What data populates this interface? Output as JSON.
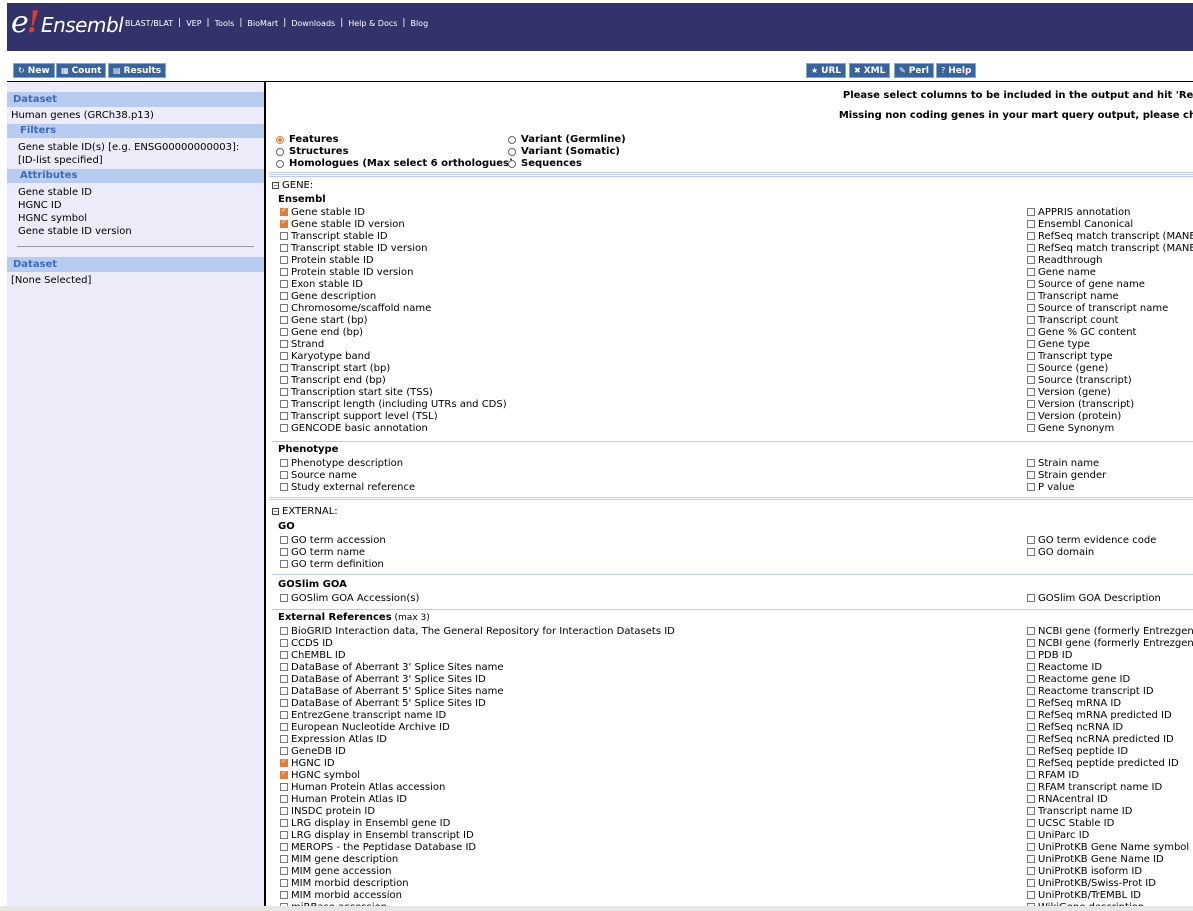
{
  "logo": {
    "e": "e",
    "bang": "!",
    "word": "Ensembl"
  },
  "topnav": [
    "BLAST/BLAT",
    "VEP",
    "Tools",
    "BioMart",
    "Downloads",
    "Help & Docs",
    "Blog"
  ],
  "toolbar": {
    "new_label": "New",
    "count_label": "Count",
    "results_label": "Results",
    "url_label": "URL",
    "xml_label": "XML",
    "perl_label": "Perl",
    "help_label": "Help"
  },
  "sidebar": {
    "dataset_head": "Dataset",
    "dataset_value": "Human genes (GRCh38.p13)",
    "filters_head": "Filters",
    "filter_value": "Gene stable ID(s) [e.g. ENSG00000000003]: [ID-list specified]",
    "attributes_head": "Attributes",
    "attributes": [
      "Gene stable ID",
      "HGNC ID",
      "HGNC symbol",
      "Gene stable ID version"
    ],
    "dataset2_head": "Dataset",
    "dataset2_value": "[None Selected]"
  },
  "messages": {
    "line1": "Please select columns to be included in the output and hit 'Results' when ready",
    "line2": "Missing non coding genes in your mart query output, please check the following"
  },
  "radios": {
    "features": "Features",
    "structures": "Structures",
    "homologues": "Homologues (Max select 6 orthologues)",
    "germline": "Variant (Germline)",
    "somatic": "Variant (Somatic)",
    "sequences": "Sequences",
    "selected": "features"
  },
  "gene_section": {
    "head": "GENE:",
    "ensembl_title": "Ensembl",
    "ensembl_left": [
      {
        "label": "Gene stable ID",
        "checked": true
      },
      {
        "label": "Gene stable ID version",
        "checked": true
      },
      {
        "label": "Transcript stable ID",
        "checked": false
      },
      {
        "label": "Transcript stable ID version",
        "checked": false
      },
      {
        "label": "Protein stable ID",
        "checked": false
      },
      {
        "label": "Protein stable ID version",
        "checked": false
      },
      {
        "label": "Exon stable ID",
        "checked": false
      },
      {
        "label": "Gene description",
        "checked": false
      },
      {
        "label": "Chromosome/scaffold name",
        "checked": false
      },
      {
        "label": "Gene start (bp)",
        "checked": false
      },
      {
        "label": "Gene end (bp)",
        "checked": false
      },
      {
        "label": "Strand",
        "checked": false
      },
      {
        "label": "Karyotype band",
        "checked": false
      },
      {
        "label": "Transcript start (bp)",
        "checked": false
      },
      {
        "label": "Transcript end (bp)",
        "checked": false
      },
      {
        "label": "Transcription start site (TSS)",
        "checked": false
      },
      {
        "label": "Transcript length (including UTRs and CDS)",
        "checked": false
      },
      {
        "label": "Transcript support level (TSL)",
        "checked": false
      },
      {
        "label": "GENCODE basic annotation",
        "checked": false
      }
    ],
    "ensembl_right": [
      {
        "label": "APPRIS annotation",
        "checked": false
      },
      {
        "label": "Ensembl Canonical",
        "checked": false
      },
      {
        "label": "RefSeq match transcript (MANE Select)",
        "checked": false
      },
      {
        "label": "RefSeq match transcript (MANE Plus Clinical)",
        "checked": false
      },
      {
        "label": "Readthrough",
        "checked": false
      },
      {
        "label": "Gene name",
        "checked": false
      },
      {
        "label": "Source of gene name",
        "checked": false
      },
      {
        "label": "Transcript name",
        "checked": false
      },
      {
        "label": "Source of transcript name",
        "checked": false
      },
      {
        "label": "Transcript count",
        "checked": false
      },
      {
        "label": "Gene % GC content",
        "checked": false
      },
      {
        "label": "Gene type",
        "checked": false
      },
      {
        "label": "Transcript type",
        "checked": false
      },
      {
        "label": "Source (gene)",
        "checked": false
      },
      {
        "label": "Source (transcript)",
        "checked": false
      },
      {
        "label": "Version (gene)",
        "checked": false
      },
      {
        "label": "Version (transcript)",
        "checked": false
      },
      {
        "label": "Version (protein)",
        "checked": false
      },
      {
        "label": "Gene Synonym",
        "checked": false
      }
    ],
    "phenotype_title": "Phenotype",
    "phenotype_left": [
      {
        "label": "Phenotype description",
        "checked": false
      },
      {
        "label": "Source name",
        "checked": false
      },
      {
        "label": "Study external reference",
        "checked": false
      }
    ],
    "phenotype_right": [
      {
        "label": "Strain name",
        "checked": false
      },
      {
        "label": "Strain gender",
        "checked": false
      },
      {
        "label": "P value",
        "checked": false
      }
    ]
  },
  "external_section": {
    "head": "EXTERNAL:",
    "go_title": "GO",
    "go_left": [
      {
        "label": "GO term accession",
        "checked": false
      },
      {
        "label": "GO term name",
        "checked": false
      },
      {
        "label": "GO term definition",
        "checked": false
      }
    ],
    "go_right": [
      {
        "label": "GO term evidence code",
        "checked": false
      },
      {
        "label": "GO domain",
        "checked": false
      }
    ],
    "goslim_title": "GOSlim GOA",
    "goslim_left": [
      {
        "label": "GOSlim GOA Accession(s)",
        "checked": false
      }
    ],
    "goslim_right": [
      {
        "label": "GOSlim GOA Description",
        "checked": false
      }
    ],
    "xref_title": "External References",
    "xref_note": " (max 3)",
    "xref_left": [
      {
        "label": "BioGRID Interaction data, The General Repository for Interaction Datasets ID",
        "checked": false
      },
      {
        "label": "CCDS ID",
        "checked": false
      },
      {
        "label": "ChEMBL ID",
        "checked": false
      },
      {
        "label": "DataBase of Aberrant 3' Splice Sites name",
        "checked": false
      },
      {
        "label": "DataBase of Aberrant 3' Splice Sites ID",
        "checked": false
      },
      {
        "label": "DataBase of Aberrant 5' Splice Sites name",
        "checked": false
      },
      {
        "label": "DataBase of Aberrant 5' Splice Sites ID",
        "checked": false
      },
      {
        "label": "EntrezGene transcript name ID",
        "checked": false
      },
      {
        "label": "European Nucleotide Archive ID",
        "checked": false
      },
      {
        "label": "Expression Atlas ID",
        "checked": false
      },
      {
        "label": "GeneDB ID",
        "checked": false
      },
      {
        "label": "HGNC ID",
        "checked": true
      },
      {
        "label": "HGNC symbol",
        "checked": true
      },
      {
        "label": "Human Protein Atlas accession",
        "checked": false
      },
      {
        "label": "Human Protein Atlas ID",
        "checked": false
      },
      {
        "label": "INSDC protein ID",
        "checked": false
      },
      {
        "label": "LRG display in Ensembl gene ID",
        "checked": false
      },
      {
        "label": "LRG display in Ensembl transcript ID",
        "checked": false
      },
      {
        "label": "MEROPS - the Peptidase Database ID",
        "checked": false
      },
      {
        "label": "MIM gene description",
        "checked": false
      },
      {
        "label": "MIM gene accession",
        "checked": false
      },
      {
        "label": "MIM morbid description",
        "checked": false
      },
      {
        "label": "MIM morbid accession",
        "checked": false
      },
      {
        "label": "miRBase accession",
        "checked": false
      }
    ],
    "xref_right": [
      {
        "label": "NCBI gene (formerly Entrezgene) ID",
        "checked": false
      },
      {
        "label": "NCBI gene (formerly Entrezgene) accession",
        "checked": false
      },
      {
        "label": "PDB ID",
        "checked": false
      },
      {
        "label": "Reactome ID",
        "checked": false
      },
      {
        "label": "Reactome gene ID",
        "checked": false
      },
      {
        "label": "Reactome transcript ID",
        "checked": false
      },
      {
        "label": "RefSeq mRNA ID",
        "checked": false
      },
      {
        "label": "RefSeq mRNA predicted ID",
        "checked": false
      },
      {
        "label": "RefSeq ncRNA ID",
        "checked": false
      },
      {
        "label": "RefSeq ncRNA predicted ID",
        "checked": false
      },
      {
        "label": "RefSeq peptide ID",
        "checked": false
      },
      {
        "label": "RefSeq peptide predicted ID",
        "checked": false
      },
      {
        "label": "RFAM ID",
        "checked": false
      },
      {
        "label": "RFAM transcript name ID",
        "checked": false
      },
      {
        "label": "RNAcentral ID",
        "checked": false
      },
      {
        "label": "Transcript name ID",
        "checked": false
      },
      {
        "label": "UCSC Stable ID",
        "checked": false
      },
      {
        "label": "UniParc ID",
        "checked": false
      },
      {
        "label": "UniProtKB Gene Name symbol",
        "checked": false
      },
      {
        "label": "UniProtKB Gene Name ID",
        "checked": false
      },
      {
        "label": "UniProtKB isoform ID",
        "checked": false
      },
      {
        "label": "UniProtKB/Swiss-Prot ID",
        "checked": false
      },
      {
        "label": "UniProtKB/TrEMBL ID",
        "checked": false
      },
      {
        "label": "WikiGene description",
        "checked": false
      }
    ]
  }
}
